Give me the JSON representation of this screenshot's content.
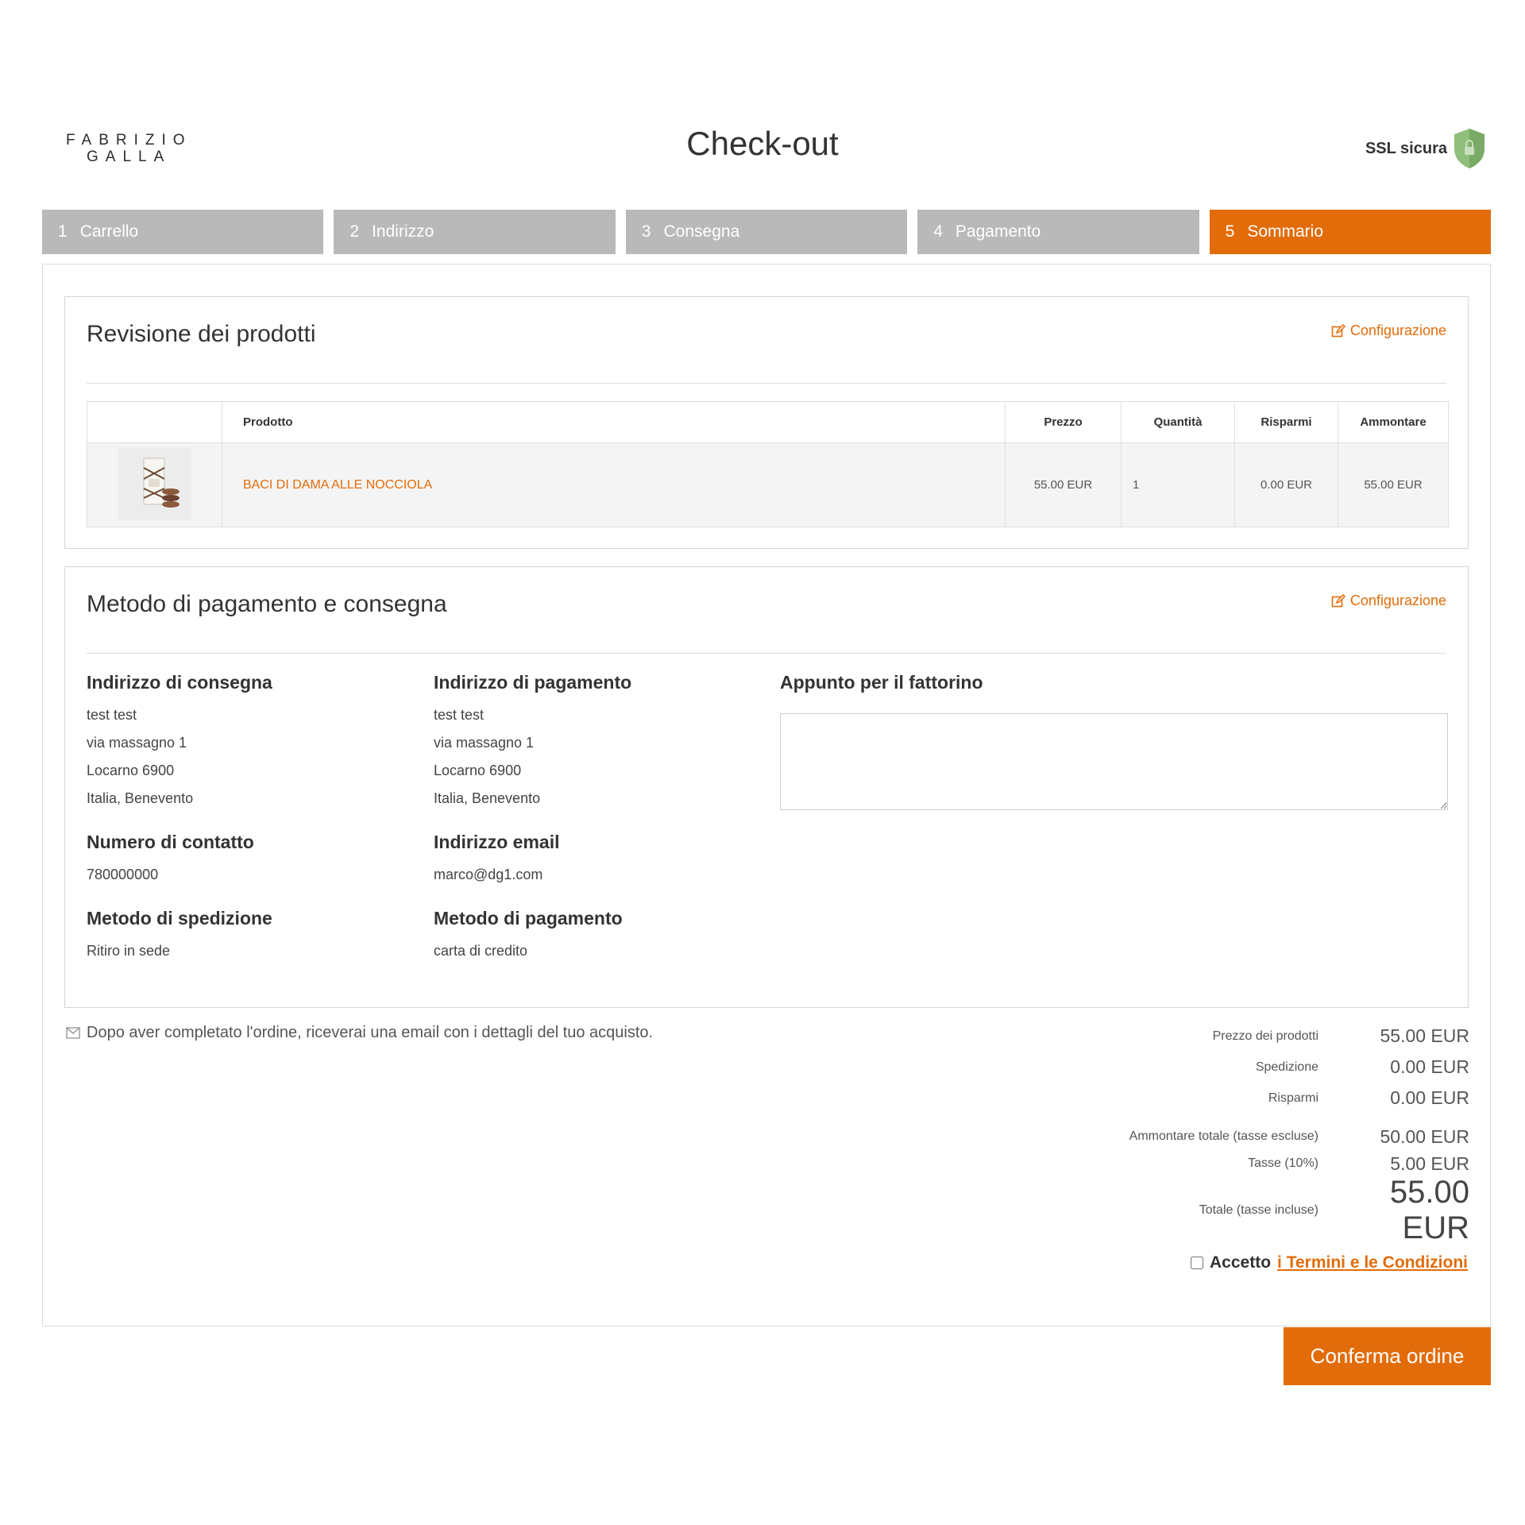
{
  "header": {
    "logo_line1": "FABRIZIO",
    "logo_line2": "GALLA",
    "title": "Check-out",
    "ssl_label": "SSL sicura",
    "ssl_icon": "shield-lock-icon"
  },
  "steps": [
    {
      "num": "1",
      "label": "Carrello",
      "active": false
    },
    {
      "num": "2",
      "label": "Indirizzo",
      "active": false
    },
    {
      "num": "3",
      "label": "Consegna",
      "active": false
    },
    {
      "num": "4",
      "label": "Pagamento",
      "active": false
    },
    {
      "num": "5",
      "label": "Sommario",
      "active": true
    }
  ],
  "review": {
    "title": "Revisione dei prodotti",
    "edit_label": "Configurazione",
    "columns": [
      "",
      "Prodotto",
      "Prezzo",
      "Quantità",
      "Risparmi",
      "Ammontare"
    ],
    "rows": [
      {
        "name": "BACI DI DAMA ALLE NOCCIOLA",
        "price": "55.00 EUR",
        "qty": "1",
        "savings": "0.00 EUR",
        "amount": "55.00 EUR"
      }
    ]
  },
  "details": {
    "title": "Metodo di pagamento e consegna",
    "edit_label": "Configurazione",
    "shipping_address": {
      "heading": "Indirizzo di consegna",
      "lines": [
        "test test",
        "via massagno 1",
        "Locarno 6900",
        "Italia, Benevento"
      ]
    },
    "billing_address": {
      "heading": "Indirizzo di pagamento",
      "lines": [
        "test test",
        "via massagno 1",
        "Locarno 6900",
        "Italia, Benevento"
      ]
    },
    "courier_note": {
      "heading": "Appunto per il fattorino",
      "value": ""
    },
    "contact": {
      "heading": "Numero di contatto",
      "value": "780000000"
    },
    "email": {
      "heading": "Indirizzo email",
      "value": "marco@dg1.com"
    },
    "shipping_method": {
      "heading": "Metodo di spedizione",
      "value": "Ritiro in sede"
    },
    "payment_method": {
      "heading": "Metodo di pagamento",
      "value": "carta di credito"
    }
  },
  "info_text": "Dopo aver completato l'ordine, riceverai una email con i dettagli del tuo acquisto.",
  "summary": {
    "products_label": "Prezzo dei prodotti",
    "products_value": "55.00 EUR",
    "shipping_label": "Spedizione",
    "shipping_value": "0.00 EUR",
    "savings_label": "Risparmi",
    "savings_value": "0.00 EUR",
    "subtotal_label": "Ammontare totale (tasse escluse)",
    "subtotal_value": "50.00 EUR",
    "tax_label": "Tasse (10%)",
    "tax_value": "5.00 EUR",
    "total_label": "Totale (tasse incluse)",
    "total_value": "55.00 EUR"
  },
  "terms": {
    "accept": "Accetto",
    "link": "i Termini e le Condizioni",
    "checked": false
  },
  "confirm_label": "Conferma ordine",
  "colors": {
    "accent": "#e36c0a",
    "step_inactive": "#b9b9b9",
    "shield": "#8fbf7a"
  }
}
